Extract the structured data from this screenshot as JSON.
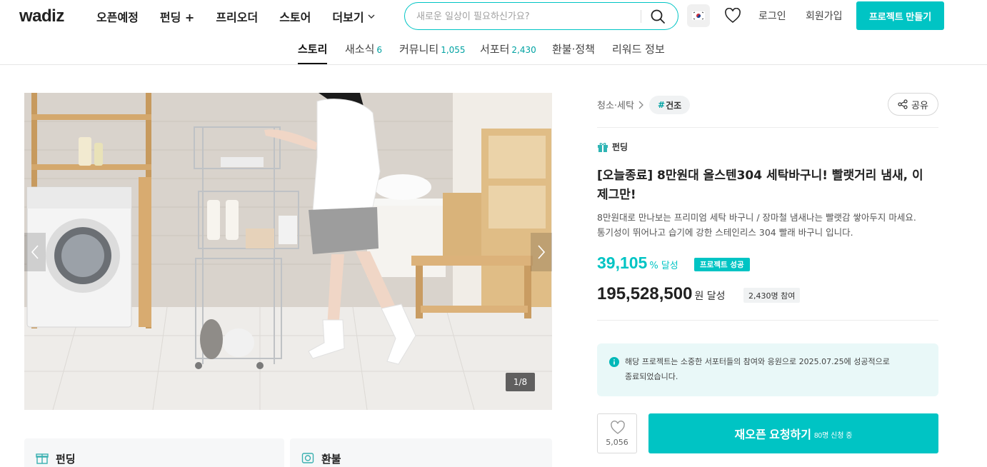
{
  "header": {
    "logo": "wadiz",
    "nav": [
      "오픈예정",
      "펀딩 +",
      "프리오더",
      "스토어",
      "더보기"
    ],
    "search_placeholder": "새로운 일상이 필요하신가요?",
    "login": "로그인",
    "signup": "회원가입",
    "make_project": "프로젝트 만들기"
  },
  "tabs": [
    {
      "label": "스토리",
      "count": ""
    },
    {
      "label": "새소식",
      "count": "6"
    },
    {
      "label": "커뮤니티",
      "count": "1,055"
    },
    {
      "label": "서포터",
      "count": "2,430"
    },
    {
      "label": "환불·정책",
      "count": ""
    },
    {
      "label": "리워드 정보",
      "count": ""
    }
  ],
  "gallery": {
    "counter": "1/8"
  },
  "cards": {
    "funding": "펀딩",
    "refund": "환불"
  },
  "project": {
    "category": "청소·세탁",
    "tag": "건조",
    "share": "공유",
    "type": "펀딩",
    "title": "[오늘종료] 8만원대 올스텐304 세탁바구니! 빨랫거리 냄새, 이제그만!",
    "desc_line1": "8만원대로 만나보는 프리미엄 세탁 바구니 / 장마철 냄새나는 빨랫감 쌓아두지 마세요.",
    "desc_line2": "통기성이 뛰어나고 습기에 강한 스테인리스 304 빨래 바구니 입니다.",
    "rate": "39,105",
    "rate_unit": "% 달성",
    "success_badge": "프로젝트 성공",
    "amount": "195,528,500",
    "amount_unit": "원 달성",
    "supporters": "2,430명 참여",
    "notice_line1": "해당 프로젝트는 소중한 서포터들의 참여와 응원으로 2025.07.25에 성공적으로",
    "notice_line2": "종료되었습니다.",
    "likes": "5,056",
    "reopen_label": "재오픈 요청하기",
    "reopen_sub": "80명 신청 중"
  },
  "colors": {
    "brand": "#00c4c4"
  }
}
